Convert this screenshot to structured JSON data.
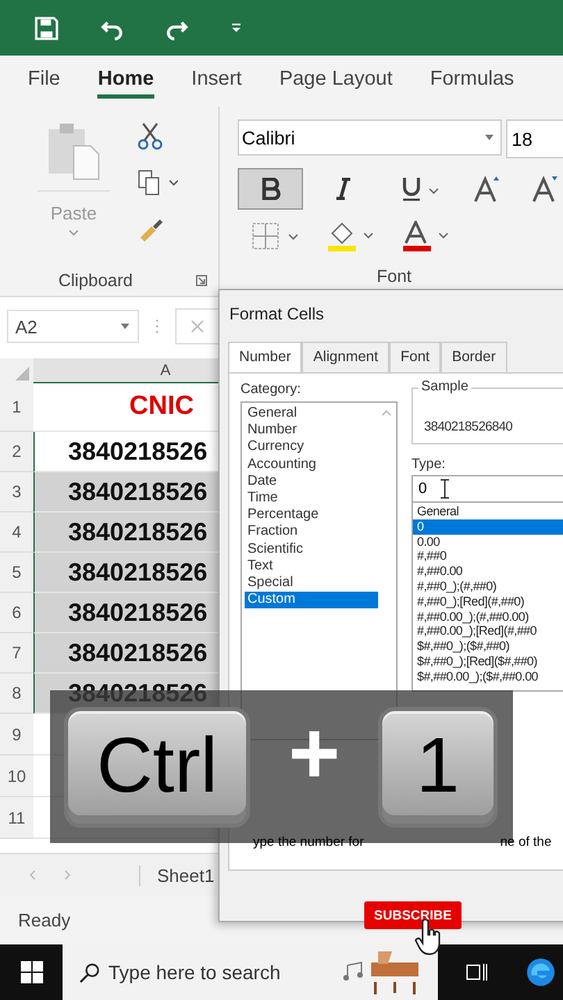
{
  "ribbon_tabs": [
    {
      "label": "File",
      "selected": false
    },
    {
      "label": "Home",
      "selected": true
    },
    {
      "label": "Insert",
      "selected": false
    },
    {
      "label": "Page Layout",
      "selected": false
    },
    {
      "label": "Formulas",
      "selected": false
    }
  ],
  "clipboard": {
    "paste_label": "Paste",
    "group_label": "Clipboard"
  },
  "font": {
    "name": "Calibri",
    "size": "18",
    "bold": true,
    "group_label": "Font"
  },
  "name_box": "A2",
  "sheet": {
    "column": "A",
    "rows": [
      {
        "number": "1",
        "value": "CNIC",
        "kind": "header"
      },
      {
        "number": "2",
        "value": "3840218526",
        "kind": "value",
        "selected": false
      },
      {
        "number": "3",
        "value": "3840218526",
        "kind": "value",
        "selected": true
      },
      {
        "number": "4",
        "value": "3840218526",
        "kind": "value",
        "selected": true
      },
      {
        "number": "5",
        "value": "3840218526",
        "kind": "value",
        "selected": true
      },
      {
        "number": "6",
        "value": "3840218526",
        "kind": "value",
        "selected": true
      },
      {
        "number": "7",
        "value": "3840218526",
        "kind": "value",
        "selected": true
      },
      {
        "number": "8",
        "value": "3840218526",
        "kind": "value",
        "selected": true
      },
      {
        "number": "9",
        "kind": "empty"
      },
      {
        "number": "10",
        "kind": "empty"
      },
      {
        "number": "11",
        "kind": "empty"
      }
    ]
  },
  "sheet_tab": "Sheet1",
  "status": "Ready",
  "taskbar": {
    "search_placeholder": "Type here to search"
  },
  "dialog": {
    "title": "Format Cells",
    "tabs": [
      {
        "label": "Number",
        "selected": true
      },
      {
        "label": "Alignment",
        "selected": false
      },
      {
        "label": "Font",
        "selected": false
      },
      {
        "label": "Border",
        "selected": false
      }
    ],
    "category_label": "Category:",
    "categories": [
      {
        "label": "General",
        "selected": false
      },
      {
        "label": "Number",
        "selected": false
      },
      {
        "label": "Currency",
        "selected": false
      },
      {
        "label": "Accounting",
        "selected": false
      },
      {
        "label": "Date",
        "selected": false
      },
      {
        "label": "Time",
        "selected": false
      },
      {
        "label": "Percentage",
        "selected": false
      },
      {
        "label": "Fraction",
        "selected": false
      },
      {
        "label": "Scientific",
        "selected": false
      },
      {
        "label": "Text",
        "selected": false
      },
      {
        "label": "Special",
        "selected": false
      },
      {
        "label": "Custom",
        "selected": true
      }
    ],
    "sample_label": "Sample",
    "sample": "3840218526840",
    "type_label": "Type:",
    "type_value": "0",
    "types": [
      {
        "label": "General",
        "selected": false
      },
      {
        "label": "0",
        "selected": true
      },
      {
        "label": "0.00",
        "selected": false
      },
      {
        "label": "#,##0",
        "selected": false
      },
      {
        "label": "#,##0.00",
        "selected": false
      },
      {
        "label": "#,##0_);(#,##0)",
        "selected": false
      },
      {
        "label": "#,##0_);[Red](#,##0)",
        "selected": false
      },
      {
        "label": "#,##0.00_);(#,##0.00)",
        "selected": false
      },
      {
        "label": "#,##0.00_);[Red](#,##0",
        "selected": false
      },
      {
        "label": "$#,##0_);($#,##0)",
        "selected": false
      },
      {
        "label": "$#,##0_);[Red]($#,##0)",
        "selected": false
      },
      {
        "label": "$#,##0.00_);($#,##0.00",
        "selected": false
      }
    ],
    "hint_parts": [
      "ype the number for",
      "ne of the"
    ]
  },
  "overlay": {
    "keys": [
      "Ctrl",
      "1"
    ],
    "plus": "+"
  },
  "subscribe": "SUBSCRIBE"
}
